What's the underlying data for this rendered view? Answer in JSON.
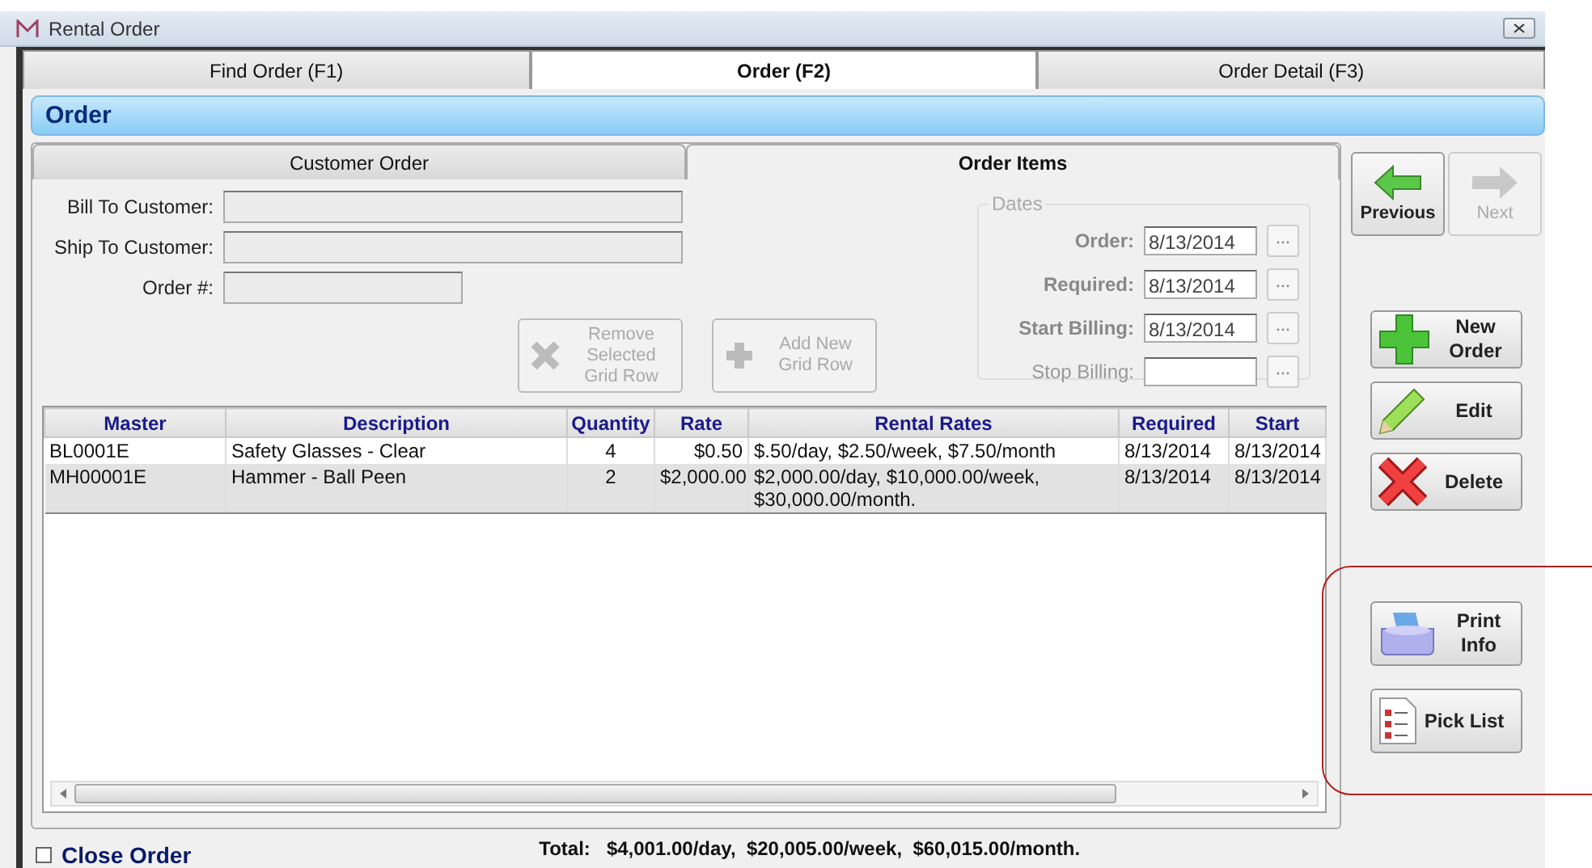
{
  "window": {
    "title": "Rental Order"
  },
  "tabs": [
    {
      "label": "Find Order (F1)",
      "selected": false
    },
    {
      "label": "Order (F2)",
      "selected": true
    },
    {
      "label": "Order Detail (F3)",
      "selected": false
    }
  ],
  "header": {
    "title": "Order"
  },
  "subtabs": [
    {
      "label": "Customer Order",
      "selected": false
    },
    {
      "label": "Order Items",
      "selected": true
    }
  ],
  "customer_fields": [
    {
      "label": "Bill To Customer:"
    },
    {
      "label": "Ship To Customer:"
    },
    {
      "label": "Order #:"
    }
  ],
  "grid_buttons": [
    {
      "label": "Remove Selected Grid Row",
      "kind": "remove",
      "disabled": true
    },
    {
      "label": "Add New Grid Row",
      "kind": "add",
      "disabled": true
    }
  ],
  "dates": {
    "title": "Dates",
    "fields": [
      {
        "label": "Order:",
        "value": "8/13/2014",
        "required": true
      },
      {
        "label": "Required:",
        "value": "8/13/2014",
        "required": true
      },
      {
        "label": "Start Billing:",
        "value": "8/13/2014",
        "required": true
      },
      {
        "label": "Stop Billing:",
        "required": false
      }
    ]
  },
  "table": {
    "columns": [
      "Master",
      "Description",
      "Quantity",
      "Rate",
      "Rental Rates",
      "Required",
      "Start"
    ],
    "rows": [
      {
        "cells": [
          "BL0001E",
          "Safety Glasses - Clear",
          "4",
          "$0.50",
          "$.50/day,  $2.50/week,  $7.50/month",
          "8/13/2014",
          "8/13/2014"
        ],
        "selected": false
      },
      {
        "cells": [
          "MH00001E",
          "Hammer - Ball Peen",
          "2",
          "$2,000.00",
          "$2,000.00/day, $10,000.00/week, $30,000.00/month.",
          "8/13/2014",
          "8/13/2014"
        ],
        "selected": true
      }
    ]
  },
  "close_order": {
    "label": "Close Order",
    "checked": false
  },
  "total": {
    "label": "Total:",
    "value": "$4,001.00/day,  $20,005.00/week,  $60,015.00/month."
  },
  "nav": [
    {
      "label": "Previous",
      "kind": "previous",
      "disabled": false
    },
    {
      "label": "Next",
      "kind": "next",
      "disabled": true
    }
  ],
  "actions": [
    {
      "label": "New Order",
      "kind": "new"
    },
    {
      "label": "Edit",
      "kind": "edit"
    },
    {
      "label": "Delete",
      "kind": "delete"
    }
  ],
  "reports": {
    "highlighted": true,
    "buttons": [
      {
        "label": "Print Info",
        "kind": "print"
      },
      {
        "label": "Pick List",
        "kind": "list"
      }
    ]
  }
}
